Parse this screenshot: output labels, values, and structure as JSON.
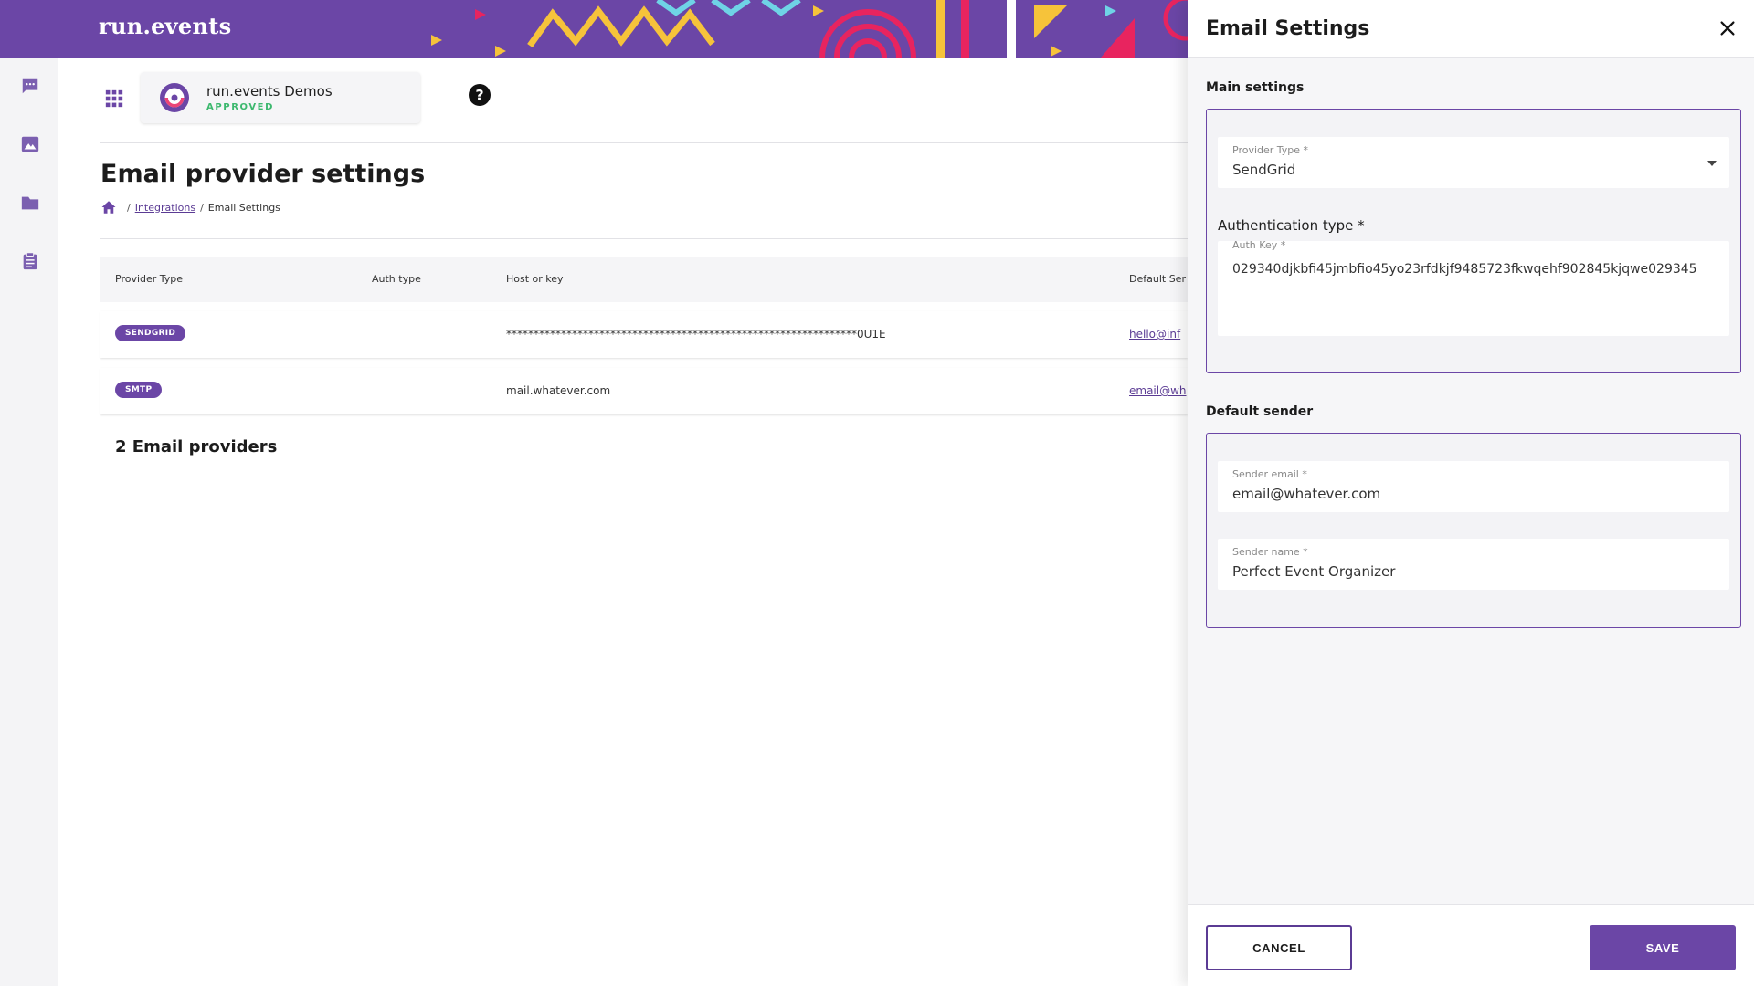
{
  "app": {
    "logo_text": "run.events"
  },
  "org": {
    "name": "run.events Demos",
    "status": "APPROVED"
  },
  "page": {
    "title": "Email provider settings",
    "breadcrumb": {
      "link": "Integrations",
      "current": "Email Settings",
      "separator": "/"
    }
  },
  "table": {
    "headers": {
      "type": "Provider Type",
      "auth": "Auth type",
      "host": "Host or key",
      "sender": "Default Ser"
    },
    "rows": [
      {
        "type": "SENDGRID",
        "auth": "",
        "host": "****************************************************************0U1E",
        "sender": "hello@inf"
      },
      {
        "type": "SMTP",
        "auth": "",
        "host": "mail.whatever.com",
        "sender": "email@wh"
      }
    ],
    "count_label": "2 Email providers"
  },
  "drawer": {
    "title": "Email Settings",
    "main_section": "Main settings",
    "provider_type": {
      "label": "Provider Type *",
      "value": "SendGrid"
    },
    "auth_type_label": "Authentication type *",
    "auth_key": {
      "label": "Auth Key *",
      "value": "029340djkbfi45jmbfio45yo23rfdkjf9485723fkwqehf902845kjqwe029345"
    },
    "sender_section": "Default sender",
    "sender_email": {
      "label": "Sender email *",
      "value": "email@whatever.com"
    },
    "sender_name": {
      "label": "Sender name *",
      "value": "Perfect Event Organizer"
    },
    "cancel_label": "CANCEL",
    "save_label": "SAVE"
  },
  "icons": {
    "rail": [
      "chat-icon",
      "image-icon",
      "folder-icon",
      "clipboard-icon"
    ],
    "apps": "apps-grid-icon",
    "help": "help-icon",
    "home": "home-icon",
    "close": "close-icon"
  },
  "colors": {
    "brand": "#6b46a6",
    "approved": "#3cb86e",
    "pattern_yellow": "#f6c33a",
    "pattern_pink": "#e8245f",
    "pattern_cyan": "#6fd3e6"
  }
}
